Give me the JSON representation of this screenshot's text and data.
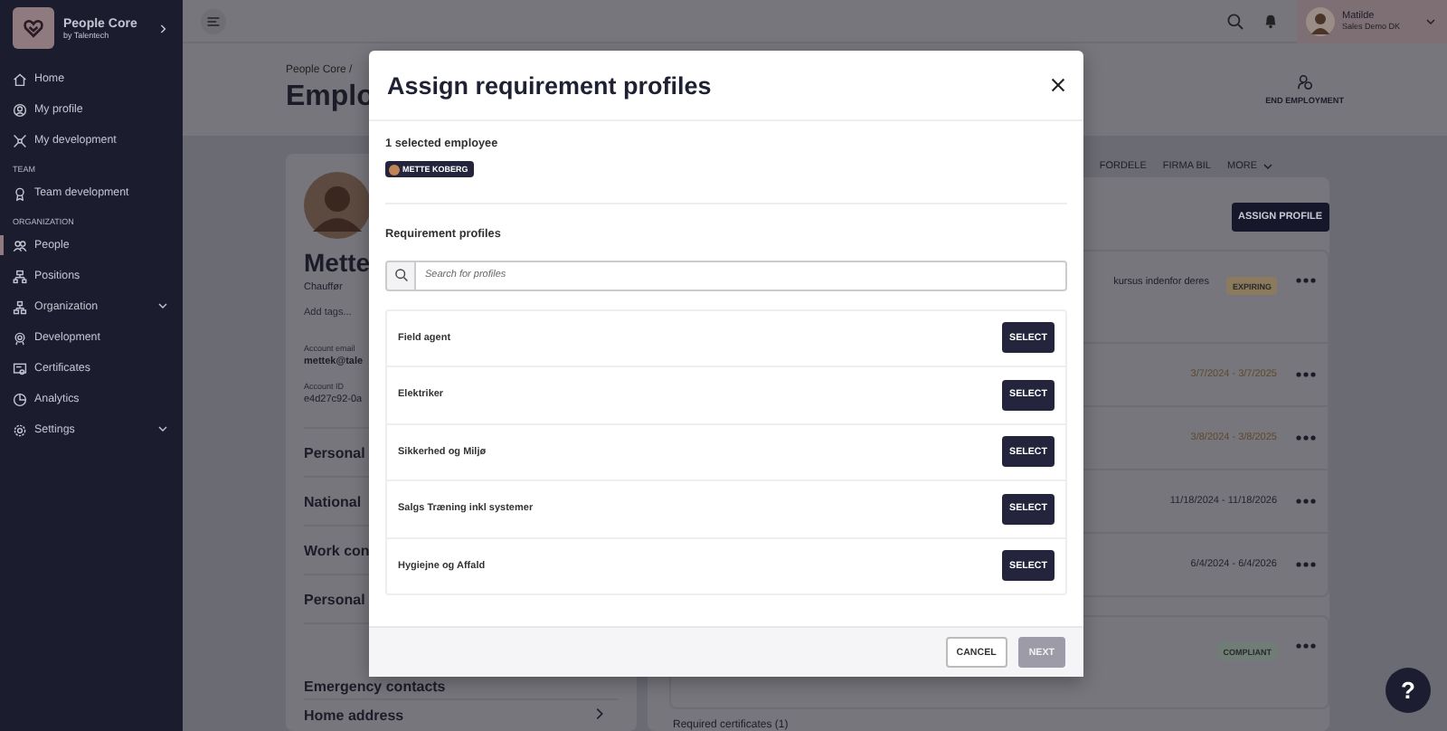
{
  "sidebar": {
    "brand": "People Core",
    "brand_sub": "by Talentech",
    "items": [
      {
        "kind": "item",
        "label": "Home",
        "selected": false,
        "expandable": false
      },
      {
        "kind": "item",
        "label": "My profile",
        "selected": false,
        "expandable": false
      },
      {
        "kind": "item",
        "label": "My development",
        "selected": false,
        "expandable": false
      },
      {
        "kind": "section",
        "label": "TEAM"
      },
      {
        "kind": "item",
        "label": "Team development",
        "selected": false,
        "expandable": false
      },
      {
        "kind": "section",
        "label": "ORGANIZATION"
      },
      {
        "kind": "item",
        "label": "People",
        "selected": true,
        "expandable": false
      },
      {
        "kind": "item",
        "label": "Positions",
        "selected": false,
        "expandable": false
      },
      {
        "kind": "item",
        "label": "Organization",
        "selected": false,
        "expandable": true
      },
      {
        "kind": "item",
        "label": "Development",
        "selected": false,
        "expandable": false
      },
      {
        "kind": "item",
        "label": "Certificates",
        "selected": false,
        "expandable": false
      },
      {
        "kind": "item",
        "label": "Analytics",
        "selected": false,
        "expandable": false
      },
      {
        "kind": "item",
        "label": "Settings",
        "selected": false,
        "expandable": true
      }
    ]
  },
  "topbar": {
    "user_name": "Matilde",
    "user_org": "Sales Demo DK"
  },
  "page": {
    "breadcrumb": "People Core /",
    "title": "Emplo",
    "end_employment": "END EMPLOYMENT"
  },
  "profile": {
    "name": "Mette",
    "role": "Chauffør",
    "tags_placeholder": "Add tags...",
    "fields": [
      {
        "label": "Account email",
        "value": "mettek@tale"
      },
      {
        "label": "Account ID",
        "value": "e4d27c92-0a"
      }
    ],
    "sections": [
      "Personal",
      "National",
      "Work con",
      "Personal",
      "Emergency contacts",
      "Home address"
    ]
  },
  "details": {
    "tabs": [
      {
        "label": "FORDELE",
        "dropdown": false
      },
      {
        "label": "FIRMA BIL",
        "dropdown": false
      },
      {
        "label": "MORE",
        "dropdown": true
      }
    ],
    "assign_button": "ASSIGN PROFILE",
    "cards": [
      {
        "rows": [
          {
            "kind": "status",
            "text": "kursus indenfor deres",
            "status": "EXPIRING",
            "color": "#8c7a5e"
          },
          {
            "kind": "date",
            "text": "3/7/2024 - 3/7/2025",
            "color": "#5e4a2c"
          },
          {
            "kind": "date",
            "text": "3/8/2024 - 3/8/2025",
            "color": "#5e4a2c"
          },
          {
            "kind": "date",
            "text": "11/18/2024 - 11/18/2026",
            "color": "#24242e"
          },
          {
            "kind": "date",
            "text": "6/4/2024 - 6/4/2026",
            "color": "#24242e"
          }
        ]
      },
      {
        "rows": [
          {
            "kind": "status",
            "text": "",
            "status": "COMPLIANT",
            "color": "#6f7d76"
          }
        ]
      }
    ],
    "footer": "Required certificates (1)"
  },
  "help": "?",
  "modal": {
    "title": "Assign requirement profiles",
    "selected_heading": "1 selected employee",
    "employees": [
      {
        "name": "METTE KOBERG"
      }
    ],
    "profiles_heading": "Requirement profiles",
    "search": {
      "placeholder": "Search for profiles"
    },
    "profiles": [
      {
        "name": "Field agent",
        "action": "SELECT"
      },
      {
        "name": "Elektriker",
        "action": "SELECT"
      },
      {
        "name": "Sikkerhed og Miljø",
        "action": "SELECT"
      },
      {
        "name": "Salgs Træning inkl systemer",
        "action": "SELECT"
      },
      {
        "name": "Hygiejne og Affald",
        "action": "SELECT"
      }
    ],
    "buttons": [
      {
        "label": "CANCEL",
        "kind": "secondary",
        "disabled": false
      },
      {
        "label": "NEXT",
        "kind": "primary",
        "disabled": true
      }
    ]
  }
}
